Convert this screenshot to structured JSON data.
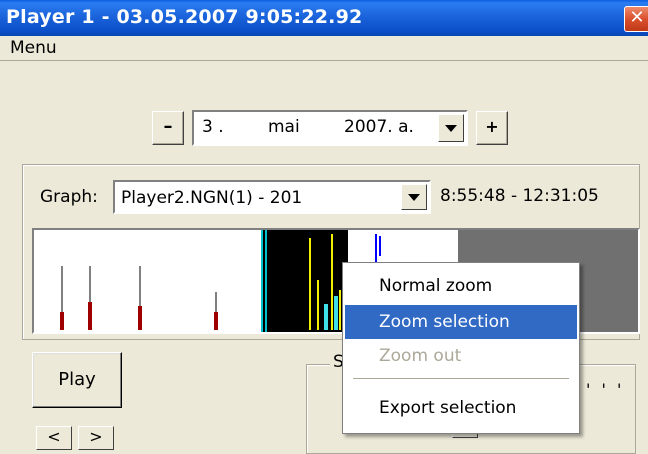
{
  "window": {
    "title": "Player 1 - 03.05.2007 9:05:22.92",
    "close_glyph": "✕"
  },
  "menu": {
    "label": "Menu"
  },
  "date": {
    "minus_label": "–",
    "plus_label": "+",
    "day": "3 .",
    "month": "mai",
    "year": "2007. a."
  },
  "graph": {
    "label": "Graph:",
    "selected": "Player2.NGN(1) - 201",
    "time_range": "8:55:48 - 12:31:05",
    "colors": {
      "background": "#ffffff",
      "selection": "#000000",
      "out_of_range": "#707070",
      "bar": "#a00000",
      "cursor": "#00c0d0",
      "yellow": "#f0f000",
      "blue": "#0000ff"
    }
  },
  "controls": {
    "play_label": "Play",
    "prev_label": "<",
    "next_label": ">",
    "speed_label": "S",
    "ticks": "' ' '"
  },
  "context_menu": {
    "items": [
      {
        "label": "Normal zoom",
        "state": "normal"
      },
      {
        "label": "Zoom selection",
        "state": "highlighted"
      },
      {
        "label": "Zoom out",
        "state": "disabled"
      },
      {
        "label": "Export selection",
        "state": "normal"
      }
    ]
  }
}
